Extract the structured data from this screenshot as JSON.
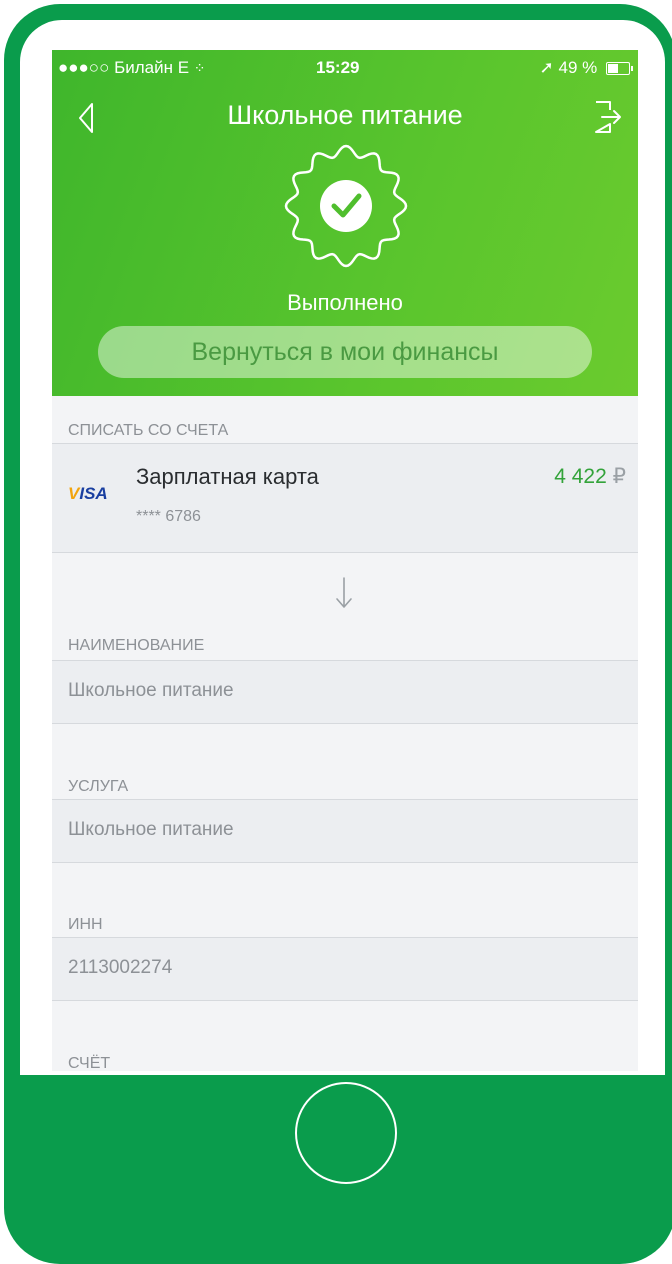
{
  "status_bar": {
    "carrier": "●●●○○ Билайн  E ",
    "time": "15:29",
    "battery_text": "49 %",
    "battery_level": 0.49
  },
  "nav": {
    "title": "Школьное питание"
  },
  "result": {
    "status": "Выполнено",
    "return_button": "Вернуться в мои финансы"
  },
  "debit": {
    "section_label": "СПИСАТЬ СО СЧЕТА",
    "card_brand": "VISA",
    "card_name": "Зарплатная карта",
    "card_number": "**** 6786",
    "amount": "4 422",
    "currency": "₽"
  },
  "fields": [
    {
      "label": "НАИМЕНОВАНИЕ",
      "value": "Школьное питание"
    },
    {
      "label": "УСЛУГА",
      "value": "Школьное питание"
    },
    {
      "label": "ИНН",
      "value": "2113002274"
    },
    {
      "label": "СЧЁТ",
      "value": ""
    }
  ],
  "colors": {
    "header_green": "#4fbe2d",
    "frame_green": "#0a9c4c",
    "amount_green": "#33a33a"
  },
  "icons": [
    "back-chevron-icon",
    "exit-icon",
    "success-badge-icon",
    "arrow-down-icon",
    "location-arrow-icon",
    "battery-icon"
  ]
}
